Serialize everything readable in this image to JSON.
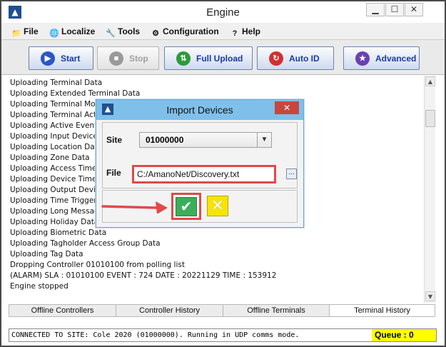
{
  "window": {
    "title": "Engine",
    "minimize_glyph": "▁",
    "maximize_glyph": "☐",
    "close_glyph": "✕",
    "logo_glyph": "▲"
  },
  "menu": [
    {
      "label": "File",
      "icon": "folder-icon",
      "glyph": "📁"
    },
    {
      "label": "Localize",
      "icon": "globe-icon",
      "glyph": "🌐"
    },
    {
      "label": "Tools",
      "icon": "tools-icon",
      "glyph": "🔧"
    },
    {
      "label": "Configuration",
      "icon": "gear-icon",
      "glyph": "⚙"
    },
    {
      "label": "Help",
      "icon": "help-icon",
      "glyph": "?"
    }
  ],
  "toolbar": {
    "start": {
      "label": "Start",
      "icon": "play-icon",
      "glyph": "▶",
      "color": "#2a56c7"
    },
    "stop": {
      "label": "Stop",
      "icon": "stop-icon",
      "glyph": "■",
      "color": "#9a9a9a"
    },
    "full_upload": {
      "label": "Full Upload",
      "icon": "upload-icon",
      "glyph": "⇅",
      "color": "#2d9a3c"
    },
    "auto_id": {
      "label": "Auto ID",
      "icon": "refresh-icon",
      "glyph": "↻",
      "color": "#d23030"
    },
    "advanced": {
      "label": "Advanced",
      "icon": "star-icon",
      "glyph": "★",
      "color": "#6a3fb2"
    }
  },
  "log_lines": [
    "Uploading Terminal Data",
    "Uploading Extended Terminal Data",
    "Uploading Terminal Mode",
    "Uploading Terminal Actio",
    "Uploading Active Events",
    "Uploading Input Device D",
    "Uploading Location Data",
    "Uploading Zone Data",
    "Uploading Access Time F",
    "Uploading Device Time Pa",
    "Uploading Output Device",
    "Uploading Time Triggered",
    "Uploading Long Message",
    "Uploading Holiday Data",
    "Uploading Biometric Data",
    "Uploading Tagholder Access Group Data",
    "Uploading Tag Data",
    "Dropping Controller 01010100 from polling list",
    "(ALARM) SLA : 01010100 EVENT : 724 DATE : 20221129 TIME : 153912",
    "Engine stopped"
  ],
  "scrollbar": {
    "up_glyph": "▲",
    "down_glyph": "▼"
  },
  "tabs": [
    "Offline Controllers",
    "Controller History",
    "Offline Terminals",
    "Terminal History"
  ],
  "status": {
    "text": "CONNECTED TO SITE: Cole 2020 (01000000). Running in UDP comms mode.",
    "queue": "Queue : 0"
  },
  "dialog": {
    "title": "Import Devices",
    "close_glyph": "✕",
    "site_label": "Site",
    "site_value": "01000000",
    "site_arrow": "▼",
    "file_label": "File",
    "file_value": "C:/AmanoNet/Discovery.txt",
    "browse_label": "...",
    "ok_glyph": "✔",
    "cancel_glyph": "✕"
  },
  "colors": {
    "highlight": "#e04a4a",
    "ok": "#3cae5a",
    "cancel": "#f7e400",
    "dialog_title": "#7fc0ea",
    "queue": "#ffff00"
  }
}
